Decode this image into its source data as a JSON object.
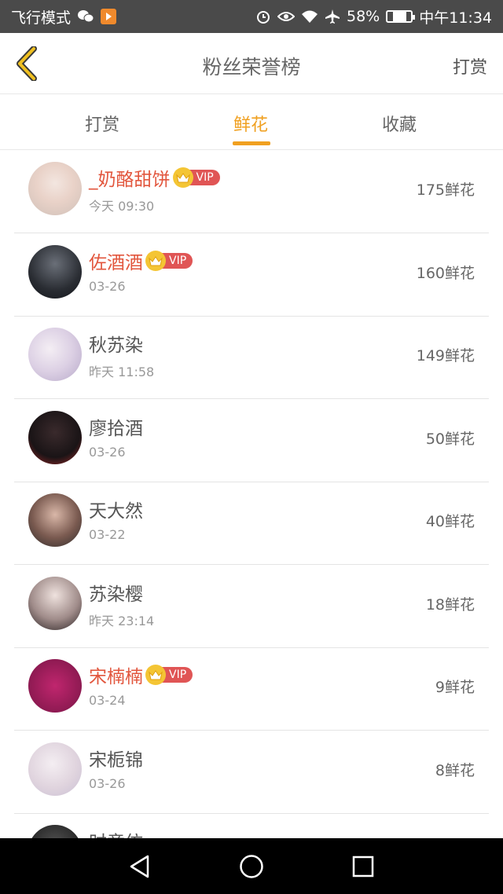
{
  "status_bar": {
    "left_text": "飞行模式",
    "battery": "58%",
    "time": "中午11:34",
    "icons": [
      "wechat-icon",
      "app-badge-icon",
      "alarm-icon",
      "eye-icon",
      "wifi-icon",
      "airplane-icon",
      "battery-icon"
    ],
    "battery_level": 0.58
  },
  "header": {
    "title": "粉丝荣誉榜",
    "action": "打赏"
  },
  "tabs": [
    {
      "label": "打赏",
      "active": false
    },
    {
      "label": "鲜花",
      "active": true
    },
    {
      "label": "收藏",
      "active": false
    }
  ],
  "colors": {
    "accent": "#f0a020",
    "vip_name": "#e2563d",
    "vip_badge": "#e05555",
    "crown": "#f4c534"
  },
  "vip_label": "VIP",
  "rows": [
    {
      "name": "_奶酪甜饼",
      "time": "今天 09:30",
      "amount": "175鲜花",
      "vip": true
    },
    {
      "name": "佐酒酒",
      "time": "03-26",
      "amount": "160鲜花",
      "vip": true
    },
    {
      "name": "秋苏染",
      "time": "昨天 11:58",
      "amount": "149鲜花",
      "vip": false
    },
    {
      "name": "廖拾酒",
      "time": "03-26",
      "amount": "50鲜花",
      "vip": false
    },
    {
      "name": "天大然",
      "time": "03-22",
      "amount": "40鲜花",
      "vip": false
    },
    {
      "name": "苏染樱",
      "time": "昨天 23:14",
      "amount": "18鲜花",
      "vip": false
    },
    {
      "name": "宋楠楠",
      "time": "03-24",
      "amount": "9鲜花",
      "vip": true
    },
    {
      "name": "宋栀锦",
      "time": "03-26",
      "amount": "8鲜花",
      "vip": false
    },
    {
      "name": "时章仿",
      "time": "",
      "amount": "",
      "vip": false
    }
  ],
  "nav": [
    "back-icon",
    "home-icon",
    "recents-icon"
  ]
}
